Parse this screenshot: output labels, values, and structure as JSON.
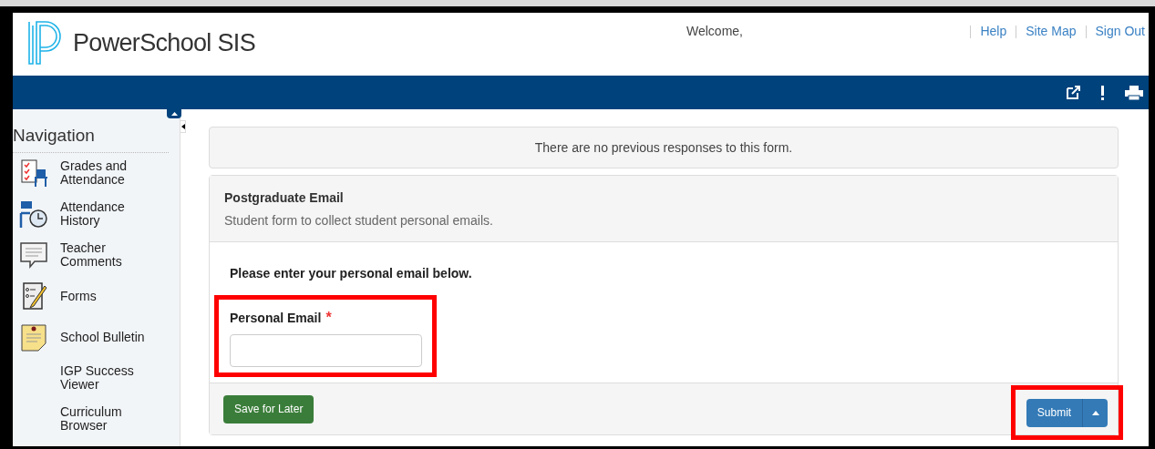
{
  "header": {
    "brand": "PowerSchool SIS",
    "welcome": "Welcome,",
    "links": [
      "Help",
      "Site Map",
      "Sign Out"
    ]
  },
  "navigation": {
    "title": "Navigation",
    "items": [
      {
        "label": "Grades and Attendance",
        "kind": "grades"
      },
      {
        "label": "Attendance History",
        "kind": "history"
      },
      {
        "label": "Teacher Comments",
        "kind": "comments"
      },
      {
        "label": "Forms",
        "kind": "forms"
      },
      {
        "label": "School Bulletin",
        "kind": "bulletin"
      },
      {
        "label": "IGP Success Viewer",
        "kind": "plain"
      },
      {
        "label": "Curriculum Browser",
        "kind": "plain"
      }
    ]
  },
  "notice": "There are no previous responses to this form.",
  "form": {
    "title": "Postgraduate Email",
    "description": "Student form to collect student personal emails.",
    "prompt": "Please enter your personal email below.",
    "field": {
      "label": "Personal Email",
      "required_mark": "*",
      "highlighted": true
    },
    "save_button": "Save for Later",
    "submit_button": "Submit",
    "submit_highlighted": true
  }
}
